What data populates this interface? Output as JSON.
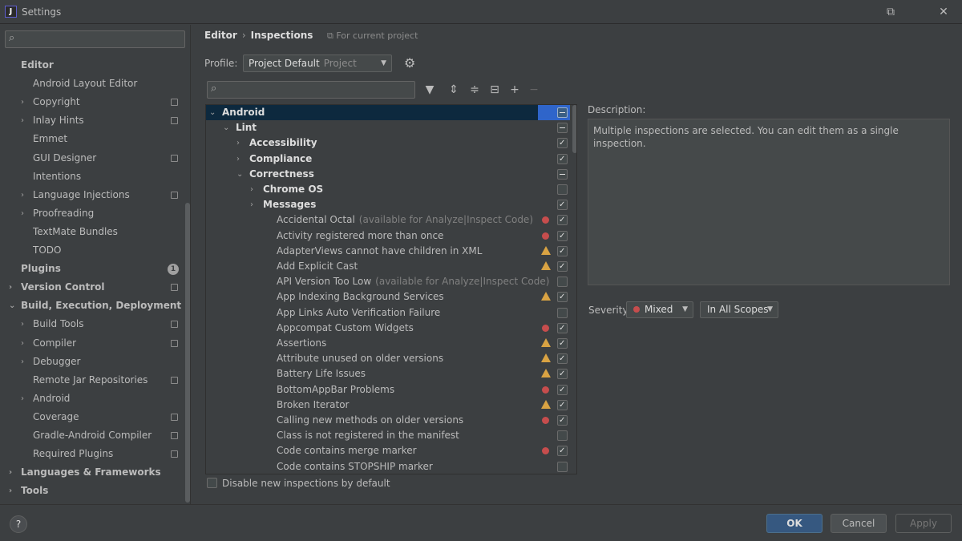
{
  "window": {
    "app_icon": "J",
    "title": "Settings"
  },
  "sidebar": {
    "search_placeholder": "",
    "items": [
      {
        "label": "Editor",
        "level": 1,
        "bold": true,
        "arrow": "",
        "copy": false
      },
      {
        "label": "Android Layout Editor",
        "level": 2,
        "bold": false,
        "arrow": "",
        "copy": false
      },
      {
        "label": "Copyright",
        "level": 2,
        "bold": false,
        "arrow": "›",
        "copy": true
      },
      {
        "label": "Inlay Hints",
        "level": 2,
        "bold": false,
        "arrow": "›",
        "copy": true
      },
      {
        "label": "Emmet",
        "level": 2,
        "bold": false,
        "arrow": "",
        "copy": false
      },
      {
        "label": "GUI Designer",
        "level": 2,
        "bold": false,
        "arrow": "",
        "copy": true
      },
      {
        "label": "Intentions",
        "level": 2,
        "bold": false,
        "arrow": "",
        "copy": false
      },
      {
        "label": "Language Injections",
        "level": 2,
        "bold": false,
        "arrow": "›",
        "copy": true
      },
      {
        "label": "Proofreading",
        "level": 2,
        "bold": false,
        "arrow": "›",
        "copy": false
      },
      {
        "label": "TextMate Bundles",
        "level": 2,
        "bold": false,
        "arrow": "",
        "copy": false
      },
      {
        "label": "TODO",
        "level": 2,
        "bold": false,
        "arrow": "",
        "copy": false
      },
      {
        "label": "Plugins",
        "level": 1,
        "bold": true,
        "arrow": "",
        "copy": false,
        "badge": "1"
      },
      {
        "label": "Version Control",
        "level": 1,
        "bold": true,
        "arrow": "›",
        "copy": true
      },
      {
        "label": "Build, Execution, Deployment",
        "level": 1,
        "bold": true,
        "arrow": "⌄",
        "copy": false
      },
      {
        "label": "Build Tools",
        "level": 2,
        "bold": false,
        "arrow": "›",
        "copy": true
      },
      {
        "label": "Compiler",
        "level": 2,
        "bold": false,
        "arrow": "›",
        "copy": true
      },
      {
        "label": "Debugger",
        "level": 2,
        "bold": false,
        "arrow": "›",
        "copy": false
      },
      {
        "label": "Remote Jar Repositories",
        "level": 2,
        "bold": false,
        "arrow": "",
        "copy": true
      },
      {
        "label": "Android",
        "level": 2,
        "bold": false,
        "arrow": "›",
        "copy": false
      },
      {
        "label": "Coverage",
        "level": 2,
        "bold": false,
        "arrow": "",
        "copy": true
      },
      {
        "label": "Gradle-Android Compiler",
        "level": 2,
        "bold": false,
        "arrow": "",
        "copy": true
      },
      {
        "label": "Required Plugins",
        "level": 2,
        "bold": false,
        "arrow": "",
        "copy": true
      },
      {
        "label": "Languages & Frameworks",
        "level": 1,
        "bold": true,
        "arrow": "›",
        "copy": false
      },
      {
        "label": "Tools",
        "level": 1,
        "bold": true,
        "arrow": "›",
        "copy": false
      }
    ]
  },
  "header": {
    "crumb_1": "Editor",
    "crumb_sep": "›",
    "crumb_2": "Inspections",
    "scope_note": "For current project"
  },
  "profile": {
    "label": "Profile:",
    "value": "Project Default",
    "value_sub": "Project"
  },
  "inspections": {
    "filter_placeholder": "",
    "rows": [
      {
        "label": "Android",
        "hint": "",
        "level": 0,
        "arrow": "⌄",
        "bold": true,
        "severity": "",
        "check": "mixed",
        "selected": true
      },
      {
        "label": "Lint",
        "hint": "",
        "level": 1,
        "arrow": "⌄",
        "bold": true,
        "severity": "",
        "check": "mixed",
        "selected": false
      },
      {
        "label": "Accessibility",
        "hint": "",
        "level": 2,
        "arrow": "›",
        "bold": true,
        "severity": "",
        "check": "on",
        "selected": false
      },
      {
        "label": "Compliance",
        "hint": "",
        "level": 2,
        "arrow": "›",
        "bold": true,
        "severity": "",
        "check": "on",
        "selected": false
      },
      {
        "label": "Correctness",
        "hint": "",
        "level": 2,
        "arrow": "⌄",
        "bold": true,
        "severity": "",
        "check": "mixed",
        "selected": false
      },
      {
        "label": "Chrome OS",
        "hint": "",
        "level": 3,
        "arrow": "›",
        "bold": true,
        "severity": "",
        "check": "off",
        "selected": false
      },
      {
        "label": "Messages",
        "hint": "",
        "level": 3,
        "arrow": "›",
        "bold": true,
        "severity": "",
        "check": "on",
        "selected": false
      },
      {
        "label": "Accidental Octal",
        "hint": "(available for Analyze|Inspect Code)",
        "level": 4,
        "arrow": "",
        "bold": false,
        "severity": "error",
        "check": "on",
        "selected": false
      },
      {
        "label": "Activity registered more than once",
        "hint": "",
        "level": 4,
        "arrow": "",
        "bold": false,
        "severity": "error",
        "check": "on",
        "selected": false
      },
      {
        "label": "AdapterViews cannot have children in XML",
        "hint": "",
        "level": 4,
        "arrow": "",
        "bold": false,
        "severity": "warning",
        "check": "on",
        "selected": false
      },
      {
        "label": "Add Explicit Cast",
        "hint": "",
        "level": 4,
        "arrow": "",
        "bold": false,
        "severity": "warning",
        "check": "on",
        "selected": false
      },
      {
        "label": "API Version Too Low",
        "hint": "(available for Analyze|Inspect Code)",
        "level": 4,
        "arrow": "",
        "bold": false,
        "severity": "",
        "check": "off",
        "selected": false
      },
      {
        "label": "App Indexing Background Services",
        "hint": "",
        "level": 4,
        "arrow": "",
        "bold": false,
        "severity": "warning",
        "check": "on",
        "selected": false
      },
      {
        "label": "App Links Auto Verification Failure",
        "hint": "",
        "level": 4,
        "arrow": "",
        "bold": false,
        "severity": "",
        "check": "off",
        "selected": false
      },
      {
        "label": "Appcompat Custom Widgets",
        "hint": "",
        "level": 4,
        "arrow": "",
        "bold": false,
        "severity": "error",
        "check": "on",
        "selected": false
      },
      {
        "label": "Assertions",
        "hint": "",
        "level": 4,
        "arrow": "",
        "bold": false,
        "severity": "warning",
        "check": "on",
        "selected": false
      },
      {
        "label": "Attribute unused on older versions",
        "hint": "",
        "level": 4,
        "arrow": "",
        "bold": false,
        "severity": "warning",
        "check": "on",
        "selected": false
      },
      {
        "label": "Battery Life Issues",
        "hint": "",
        "level": 4,
        "arrow": "",
        "bold": false,
        "severity": "warning",
        "check": "on",
        "selected": false
      },
      {
        "label": "BottomAppBar Problems",
        "hint": "",
        "level": 4,
        "arrow": "",
        "bold": false,
        "severity": "error",
        "check": "on",
        "selected": false
      },
      {
        "label": "Broken Iterator",
        "hint": "",
        "level": 4,
        "arrow": "",
        "bold": false,
        "severity": "warning",
        "check": "on",
        "selected": false
      },
      {
        "label": "Calling new methods on older versions",
        "hint": "",
        "level": 4,
        "arrow": "",
        "bold": false,
        "severity": "error",
        "check": "on",
        "selected": false
      },
      {
        "label": "Class is not registered in the manifest",
        "hint": "",
        "level": 4,
        "arrow": "",
        "bold": false,
        "severity": "",
        "check": "off",
        "selected": false
      },
      {
        "label": "Code contains merge marker",
        "hint": "",
        "level": 4,
        "arrow": "",
        "bold": false,
        "severity": "error",
        "check": "on",
        "selected": false
      },
      {
        "label": "Code contains STOPSHIP marker",
        "hint": "",
        "level": 4,
        "arrow": "",
        "bold": false,
        "severity": "",
        "check": "off",
        "selected": false
      }
    ],
    "disable_new_label": "Disable new inspections by default"
  },
  "description": {
    "label": "Description:",
    "text": "Multiple inspections are selected. You can edit them as a single inspection."
  },
  "severity": {
    "label": "Severity:",
    "value": "Mixed",
    "scope_value": "In All Scopes"
  },
  "footer": {
    "help_label": "?",
    "ok_label": "OK",
    "cancel_label": "Cancel",
    "apply_label": "Apply"
  },
  "colors": {
    "background": "#3c3f41",
    "selection": "#0d293e",
    "primary_button": "#365880",
    "error": "#c64d4d",
    "warning": "#d9a343"
  }
}
